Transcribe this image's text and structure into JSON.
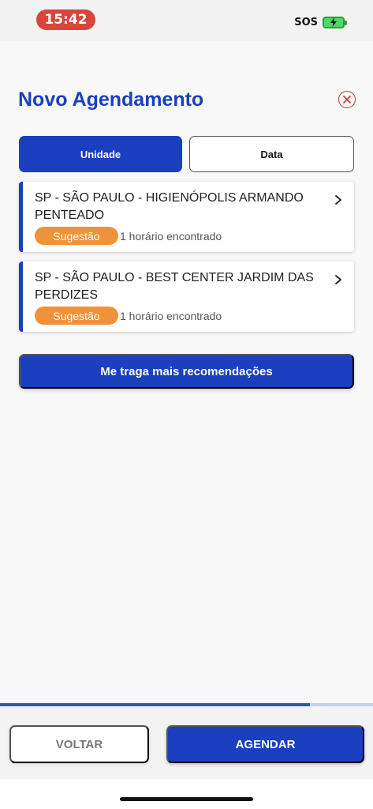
{
  "status_bar": {
    "time": "15:42",
    "sos": "SOS",
    "battery_icon": "battery-charging-icon"
  },
  "header": {
    "title": "Novo Agendamento",
    "close_icon": "close-circle-icon"
  },
  "tabs": [
    {
      "label": "Unidade",
      "active": true
    },
    {
      "label": "Data",
      "active": false
    }
  ],
  "units": [
    {
      "name": "SP - SÃO PAULO - HIGIENÓPOLIS ARMANDO PENTEADO",
      "badge": "Sugestão",
      "info": "1 horário encontrado"
    },
    {
      "name": "SP - SÃO PAULO - BEST CENTER JARDIM DAS PERDIZES",
      "badge": "Sugestão",
      "info": "1 horário encontrado"
    }
  ],
  "more_button": "Me traga mais recomendações",
  "progress": {
    "fraction": 0.83
  },
  "footer": {
    "back_label": "VOLTAR",
    "schedule_label": "AGENDAR"
  },
  "colors": {
    "primary": "#1a3fbf",
    "badge": "#f0923a",
    "close": "#c0392b",
    "time_pill": "#d9453b"
  }
}
